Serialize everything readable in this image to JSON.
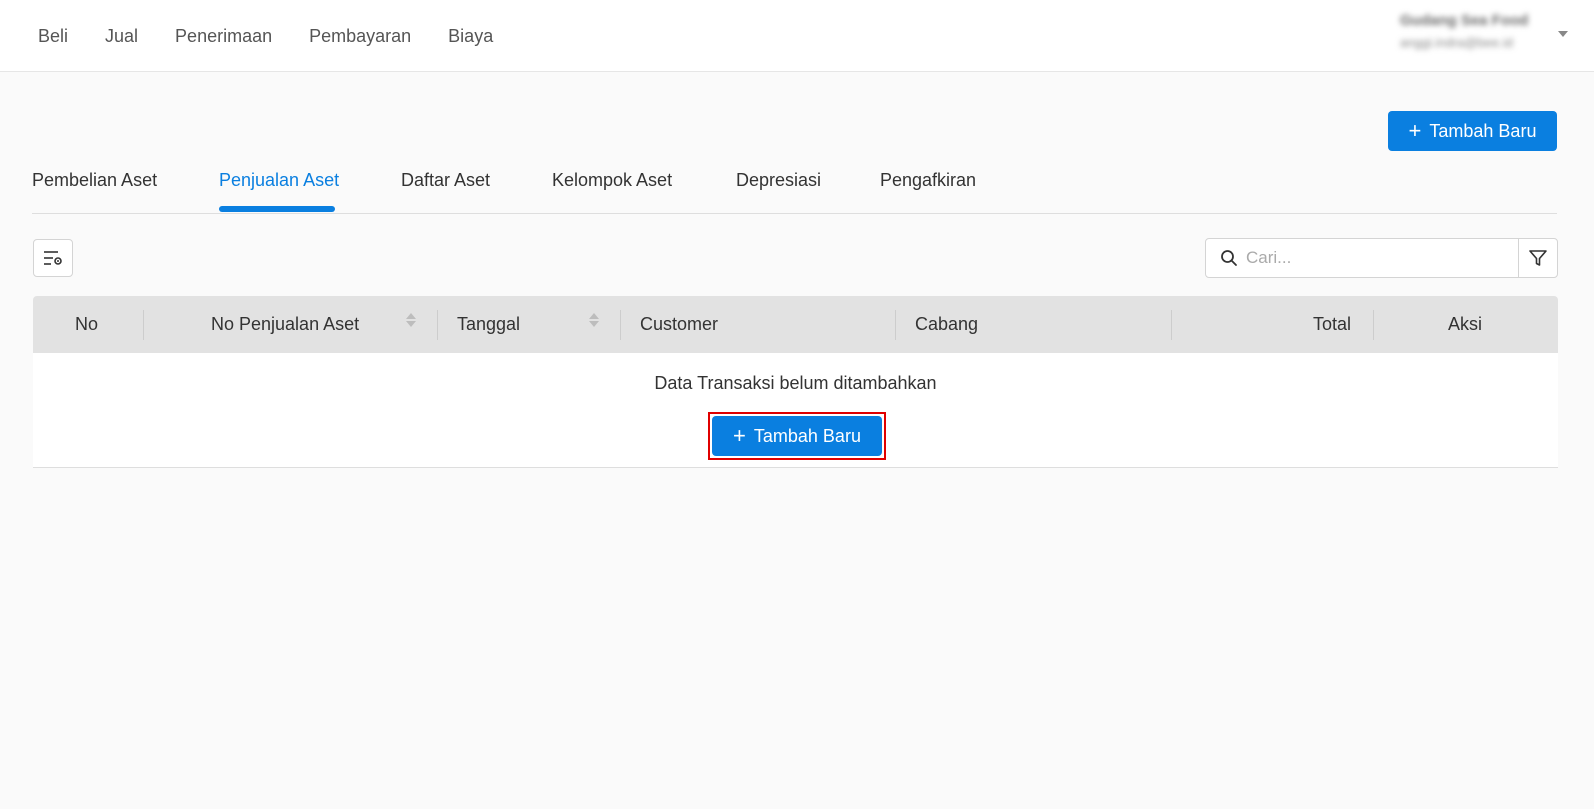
{
  "topnav": {
    "items": [
      "Beli",
      "Jual",
      "Penerimaan",
      "Pembayaran",
      "Biaya"
    ]
  },
  "account": {
    "name": "Gudang Sea Food",
    "email": "anggi.indra@bee.id"
  },
  "header": {
    "add_button_label": "Tambah Baru"
  },
  "tabs": {
    "items": [
      "Pembelian Aset",
      "Penjualan Aset",
      "Daftar Aset",
      "Kelompok Aset",
      "Depresiasi",
      "Pengafkiran"
    ],
    "active": "Penjualan Aset"
  },
  "search": {
    "placeholder": "Cari..."
  },
  "table": {
    "columns": [
      "No",
      "No Penjualan Aset",
      "Tanggal",
      "Customer",
      "Cabang",
      "Total",
      "Aksi"
    ],
    "empty_message": "Data Transaksi belum ditambahkan",
    "empty_add_label": "Tambah Baru"
  },
  "colors": {
    "primary": "#0a7fe0",
    "highlight": "#e00000"
  },
  "icons": {
    "column_settings": "column-settings-icon",
    "search": "search-icon",
    "filter": "filter-icon",
    "caret": "chevron-down-icon",
    "plus": "plus-icon"
  }
}
